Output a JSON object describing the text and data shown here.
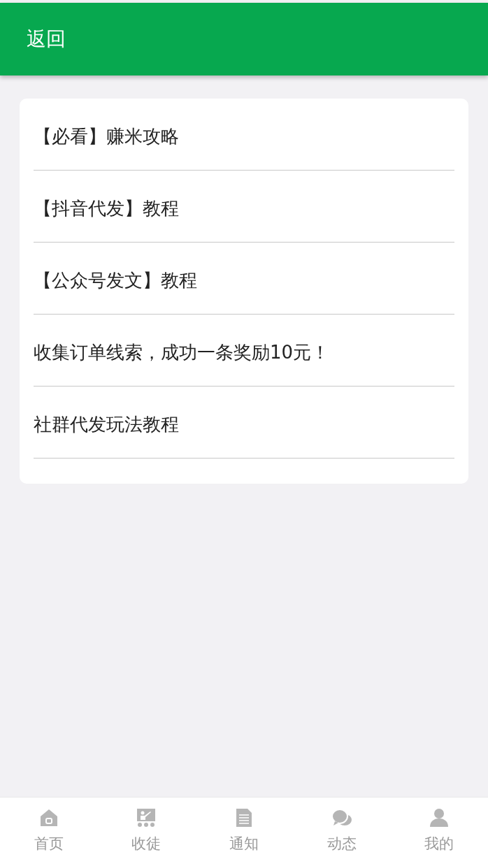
{
  "header": {
    "back_label": "返回"
  },
  "articles": [
    {
      "title": "【必看】赚米攻略"
    },
    {
      "title": "【抖音代发】教程"
    },
    {
      "title": "【公众号发文】教程"
    },
    {
      "title": "收集订单线索，成功一条奖励10元！"
    },
    {
      "title": "社群代发玩法教程"
    }
  ],
  "bottom_nav": [
    {
      "kind": "home",
      "label": "首页"
    },
    {
      "kind": "teach",
      "label": "收徒"
    },
    {
      "kind": "doc",
      "label": "通知"
    },
    {
      "kind": "chat",
      "label": "动态"
    },
    {
      "kind": "user",
      "label": "我的"
    }
  ]
}
